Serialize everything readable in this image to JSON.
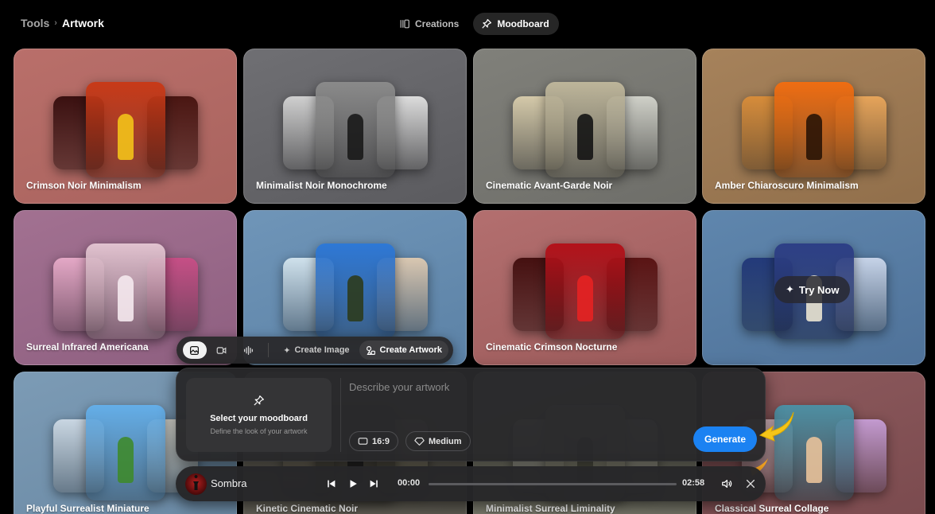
{
  "header": {
    "breadcrumb": {
      "root": "Tools",
      "separator": "›",
      "current": "Artwork"
    },
    "tabs": [
      {
        "label": "Creations",
        "icon": "library-icon",
        "active": false
      },
      {
        "label": "Moodboard",
        "icon": "pin-icon",
        "active": true
      }
    ]
  },
  "cards": [
    {
      "title": "Crimson Noir Minimalism",
      "bg": [
        "#b96f6a",
        "#a9635e"
      ],
      "thumbs": [
        "#3a1010",
        "#c83a18",
        "#4a1612"
      ],
      "accent": "#f3c21a"
    },
    {
      "title": "Minimalist Noir Monochrome",
      "bg": [
        "#6f6f73",
        "#5b5b5f"
      ],
      "thumbs": [
        "#cfcfcf",
        "#8a8a8a",
        "#dcdcdc"
      ],
      "accent": "#1a1a1a"
    },
    {
      "title": "Cinematic Avant-Garde Noir",
      "bg": [
        "#80807a",
        "#6e6e69"
      ],
      "thumbs": [
        "#d4c9a9",
        "#bdb59a",
        "#cfd0c8"
      ],
      "accent": "#141414"
    },
    {
      "title": "Amber Chiaroscuro Minimalism",
      "bg": [
        "#a6825b",
        "#916f4b"
      ],
      "thumbs": [
        "#d68c3a",
        "#ef6d12",
        "#e6a45a"
      ],
      "accent": "#2a1406"
    },
    {
      "title": "Surreal Infrared Americana",
      "bg": [
        "#a27191",
        "#8e5f80"
      ],
      "thumbs": [
        "#e4a8c6",
        "#e1c2cf",
        "#c64f86"
      ],
      "accent": "#f5e9ee"
    },
    {
      "title": "",
      "bg": [
        "#6f95b8",
        "#5c82a6"
      ],
      "thumbs": [
        "#cfe1ec",
        "#2e78d6",
        "#d9c7b1"
      ],
      "accent": "#2c3b1d"
    },
    {
      "title": "Cinematic Crimson Nocturne",
      "bg": [
        "#b36f6f",
        "#9c5b5b"
      ],
      "thumbs": [
        "#451010",
        "#b3121a",
        "#5a1414"
      ],
      "accent": "#e62222"
    },
    {
      "title": "",
      "bg": [
        "#5f86ad",
        "#4f7299"
      ],
      "thumbs": [
        "#233a7a",
        "#2d3f86",
        "#c6d3e8"
      ],
      "accent": "#e9e3d1",
      "badge": "Try Now"
    },
    {
      "title": "Playful Surrealist Miniature",
      "bg": [
        "#7c9bb5",
        "#6a89a4"
      ],
      "thumbs": [
        "#c9d6e2",
        "#64aee8",
        "#d8d8d0"
      ],
      "accent": "#3e8a2e"
    },
    {
      "title": "Kinetic Cinematic Noir",
      "bg": [
        "#6d6a5f",
        "#5b584f"
      ],
      "thumbs": [
        "#8c8470",
        "#4d4a40",
        "#9a927a"
      ],
      "accent": "#202020"
    },
    {
      "title": "Minimalist Surreal Liminality",
      "bg": [
        "#858576",
        "#707063"
      ],
      "thumbs": [
        "#d0cfc0",
        "#a8a690",
        "#c8c6b4"
      ],
      "accent": "#4d4c40"
    },
    {
      "title": "Classical Surreal Collage",
      "bg": [
        "#8d5a5d",
        "#7a4a4e"
      ],
      "thumbs": [
        "#d9b9c0",
        "#4d8fa3",
        "#c39ad0"
      ],
      "accent": "#e8c29a"
    }
  ],
  "mode_bar": {
    "modes": [
      {
        "name": "image-mode-button",
        "icon": "image-icon",
        "active": true
      },
      {
        "name": "video-mode-button",
        "icon": "video-icon",
        "active": false
      },
      {
        "name": "audio-mode-button",
        "icon": "waveform-icon",
        "active": false
      }
    ],
    "create_image": "Create Image",
    "create_artwork": "Create Artwork"
  },
  "composer": {
    "moodboard_title": "Select your moodboard",
    "moodboard_subtitle": "Define the look of your artwork",
    "prompt_placeholder": "Describe your artwork",
    "prompt_value": "",
    "aspect_ratio": "16:9",
    "quality": "Medium",
    "generate_label": "Generate"
  },
  "player": {
    "track": "Sombra",
    "current_time": "00:00",
    "duration": "02:58",
    "progress": 0
  },
  "colors": {
    "accent_blue": "#1b82f2",
    "pointer_yellow": "#f5c518",
    "pointer_orange": "#f0a020"
  }
}
